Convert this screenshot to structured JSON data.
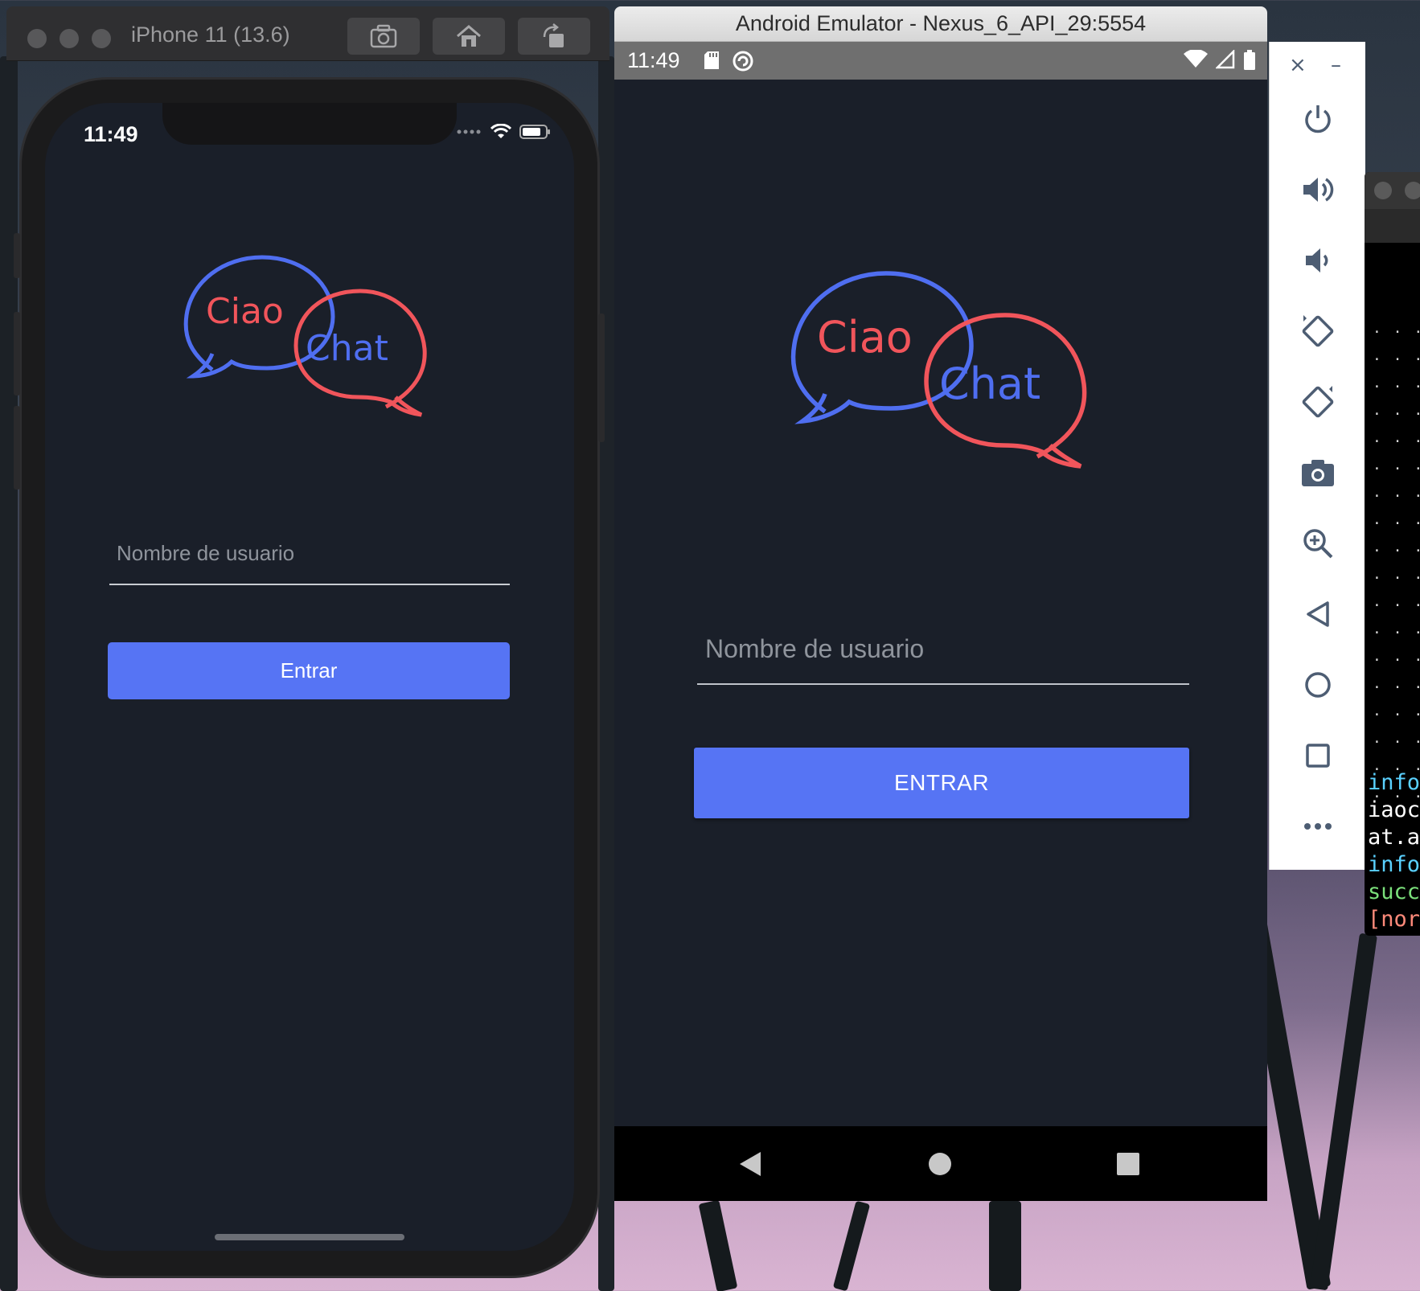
{
  "ios_window": {
    "title": "iPhone 11 (13.6)",
    "toolbar_icons": [
      "screenshot-icon",
      "home-icon",
      "rotate-icon"
    ]
  },
  "ios_app": {
    "status_time": "11:49",
    "logo_word_1": "Ciao",
    "logo_word_2": "Chat",
    "username_placeholder": "Nombre de usuario",
    "button_label": "Entrar"
  },
  "android_window": {
    "title": "Android Emulator - Nexus_6_API_29:5554"
  },
  "android_app": {
    "status_time": "11:49",
    "logo_word_1": "Ciao",
    "logo_word_2": "Chat",
    "username_placeholder": "Nombre de usuario",
    "button_label": "ENTRAR"
  },
  "emulator_toolbar": {
    "close_glyph": "×",
    "minimize_glyph": "–",
    "items": [
      "power-icon",
      "volume-up-icon",
      "volume-down-icon",
      "rotate-left-icon",
      "rotate-right-icon",
      "camera-icon",
      "zoom-icon",
      "back-icon",
      "home-icon",
      "overview-icon",
      "more-icon"
    ]
  },
  "terminal": {
    "dots": ". . . . .",
    "lines": [
      {
        "text": "info",
        "color": "#5ad1ff"
      },
      {
        "text": "iaoch",
        "color": "#ffffff"
      },
      {
        "text": "at.ap",
        "color": "#ffffff"
      },
      {
        "text": "info",
        "color": "#5ad1ff"
      },
      {
        "text": "succe",
        "color": "#7be07b"
      },
      {
        "text": "[norc",
        "color": "#ff8a7a"
      }
    ]
  },
  "colors": {
    "app_background": "#1a1f29",
    "accent_button": "#5674f4",
    "logo_blue": "#4f6ef0",
    "logo_red": "#f1555b"
  }
}
